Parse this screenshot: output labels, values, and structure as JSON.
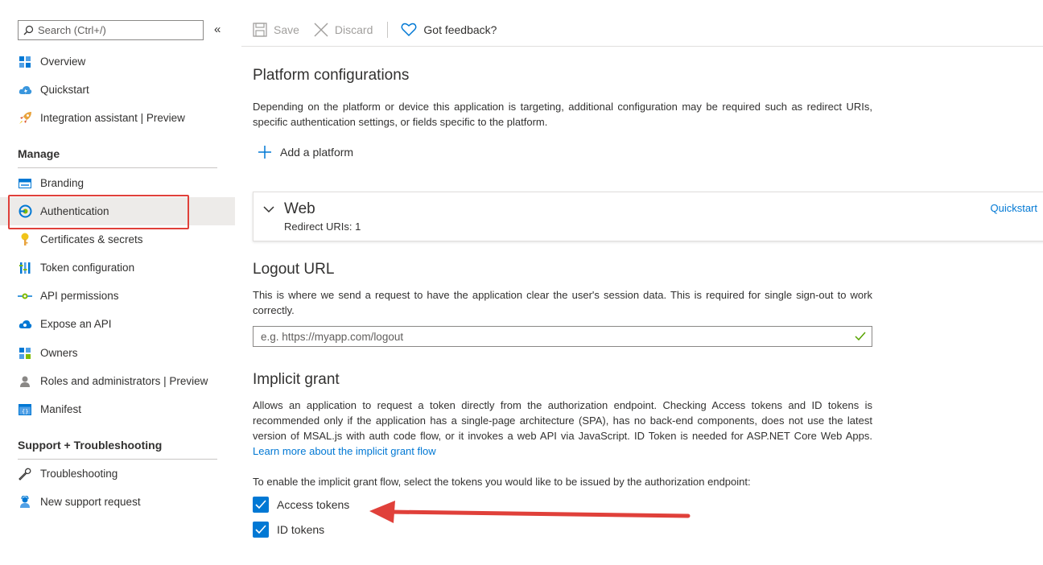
{
  "sidebar": {
    "search_placeholder": "Search (Ctrl+/)",
    "collapse_label": "«",
    "top_items": [
      {
        "label": "Overview",
        "icon": "overview-grid-icon"
      },
      {
        "label": "Quickstart",
        "icon": "cloud-lightning-icon"
      },
      {
        "label": "Integration assistant | Preview",
        "icon": "rocket-icon"
      }
    ],
    "manage_header": "Manage",
    "manage_items": [
      {
        "label": "Branding",
        "icon": "branding-icon"
      },
      {
        "label": "Authentication",
        "icon": "authentication-icon",
        "active": true
      },
      {
        "label": "Certificates & secrets",
        "icon": "key-icon"
      },
      {
        "label": "Token configuration",
        "icon": "token-bars-icon"
      },
      {
        "label": "API permissions",
        "icon": "api-permissions-icon"
      },
      {
        "label": "Expose an API",
        "icon": "cloud-expose-icon"
      },
      {
        "label": "Owners",
        "icon": "owners-grid-icon"
      },
      {
        "label": "Roles and administrators | Preview",
        "icon": "person-icon"
      },
      {
        "label": "Manifest",
        "icon": "manifest-icon"
      }
    ],
    "support_header": "Support + Troubleshooting",
    "support_items": [
      {
        "label": "Troubleshooting",
        "icon": "wrench-icon"
      },
      {
        "label": "New support request",
        "icon": "support-person-icon"
      }
    ]
  },
  "toolbar": {
    "save": "Save",
    "discard": "Discard",
    "feedback": "Got feedback?"
  },
  "platform": {
    "title": "Platform configurations",
    "description": "Depending on the platform or device this application is targeting, additional configuration may be required such as redirect URIs, specific authentication settings, or fields specific to the platform.",
    "add_label": "Add a platform",
    "web": {
      "title": "Web",
      "subtitle": "Redirect URIs: 1",
      "quickstart": "Quickstart"
    }
  },
  "logout": {
    "title": "Logout URL",
    "description": "This is where we send a request to have the application clear the user's session data. This is required for single sign-out to work correctly.",
    "placeholder": "e.g. https://myapp.com/logout"
  },
  "implicit": {
    "title": "Implicit grant",
    "description": "Allows an application to request a token directly from the authorization endpoint. Checking Access tokens and ID tokens is recommended only if the application has a single-page architecture (SPA), has no back-end components, does not use the latest version of MSAL.js with auth code flow, or it invokes a web API via JavaScript. ID Token is needed for ASP.NET Core Web Apps.",
    "learn_more": "Learn more about the implicit grant flow",
    "instruction": "To enable the implicit grant flow, select the tokens you would like to be issued by the authorization endpoint:",
    "access_tokens": {
      "label": "Access tokens",
      "checked": true
    },
    "id_tokens": {
      "label": "ID tokens",
      "checked": true
    }
  },
  "colors": {
    "accent": "#0078d4",
    "highlight": "#e0403a",
    "active_bg": "#edebe9"
  }
}
